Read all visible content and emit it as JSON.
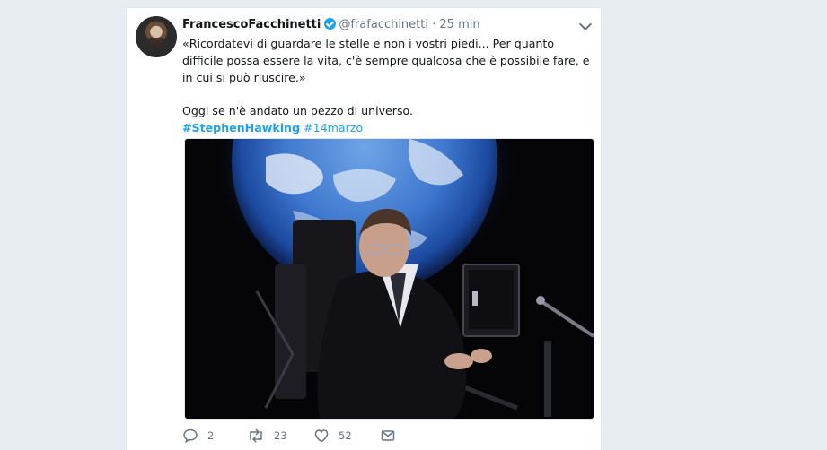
{
  "tweet": {
    "author_name": "FrancescoFacchinetti",
    "handle": "@frafacchinetti",
    "separator": "·",
    "time": "25 min",
    "text_line1": "«Ricordatevi di guardare le stelle e non i vostri piedi... Per quanto difficile possa essere la vita, c'è sempre qualcosa che è possibile fare, e in cui si può riuscire.»",
    "text_line2": "Oggi se n'è andato un pezzo di universo.",
    "hashtag1": "#StephenHawking",
    "hashtag2": "#14marzo",
    "verified": true,
    "photo_description_icon": "photo"
  },
  "actions": {
    "reply_count": "2",
    "retweet_count": "23",
    "like_count": "52"
  },
  "colors": {
    "link": "#1da1f2",
    "muted": "#657786",
    "background": "#e6ecf0"
  }
}
